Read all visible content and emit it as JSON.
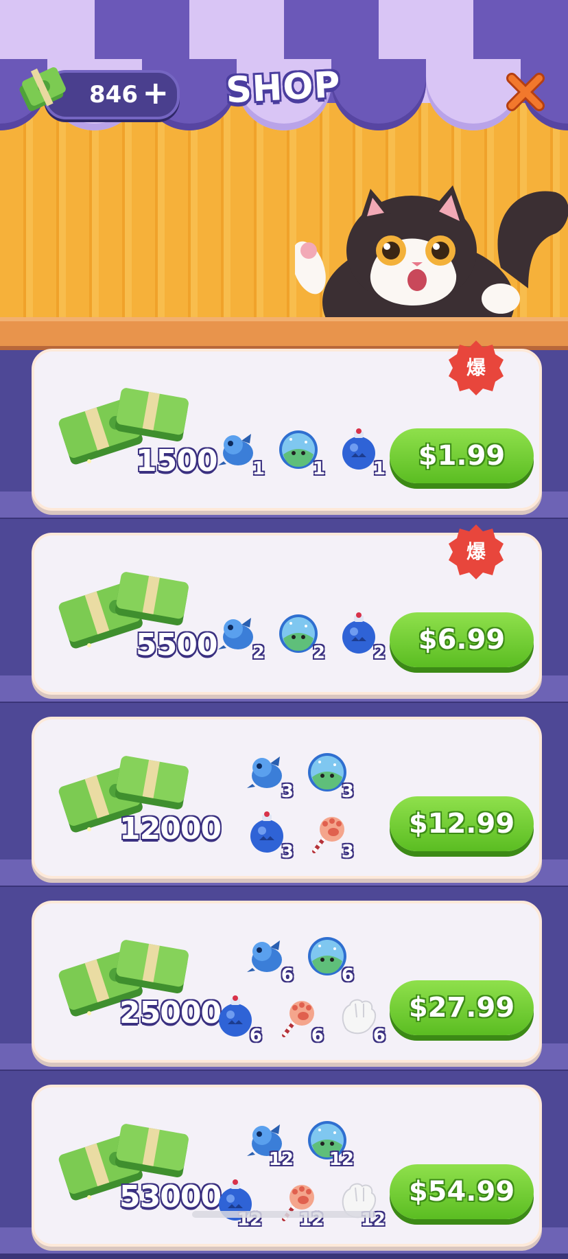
{
  "header": {
    "currency_amount": "846",
    "currency_plus": "+",
    "title": "SHOP",
    "close_label": "✕"
  },
  "colors": {
    "awning_light": "#d9c5f5",
    "awning_dark": "#6b58b8",
    "wall": "#f6b13a",
    "card": "#f4f1f8",
    "button_green": "#5bbd22",
    "badge_red": "#e8463c",
    "outline_text": "#3a3080"
  },
  "products": [
    {
      "amount": "1500",
      "hot_label": "爆",
      "price": "$1.99",
      "items": [
        {
          "icon": "blue-dragon-icon",
          "count": "1"
        },
        {
          "icon": "cat-snow-globe-icon",
          "count": "1"
        },
        {
          "icon": "blue-bomb-icon",
          "count": "1"
        }
      ]
    },
    {
      "amount": "5500",
      "hot_label": "爆",
      "price": "$6.99",
      "items": [
        {
          "icon": "blue-dragon-icon",
          "count": "2"
        },
        {
          "icon": "cat-snow-globe-icon",
          "count": "2"
        },
        {
          "icon": "blue-bomb-icon",
          "count": "2"
        }
      ]
    },
    {
      "amount": "12000",
      "hot_label": "",
      "price": "$12.99",
      "items": [
        {
          "icon": "blue-dragon-icon",
          "count": "3"
        },
        {
          "icon": "cat-snow-globe-icon",
          "count": "3"
        },
        {
          "icon": "blue-bomb-icon",
          "count": "3"
        },
        {
          "icon": "paw-wand-icon",
          "count": "3"
        }
      ]
    },
    {
      "amount": "25000",
      "hot_label": "",
      "price": "$27.99",
      "items": [
        {
          "icon": "blue-dragon-icon",
          "count": "6"
        },
        {
          "icon": "cat-snow-globe-icon",
          "count": "6"
        },
        {
          "icon": "blue-bomb-icon",
          "count": "6"
        },
        {
          "icon": "paw-wand-icon",
          "count": "6"
        },
        {
          "icon": "white-glove-icon",
          "count": "6"
        }
      ]
    },
    {
      "amount": "53000",
      "hot_label": "",
      "price": "$54.99",
      "items": [
        {
          "icon": "blue-dragon-icon",
          "count": "12"
        },
        {
          "icon": "cat-snow-globe-icon",
          "count": "12"
        },
        {
          "icon": "blue-bomb-icon",
          "count": "12"
        },
        {
          "icon": "paw-wand-icon",
          "count": "12"
        },
        {
          "icon": "white-glove-icon",
          "count": "12"
        }
      ]
    }
  ]
}
